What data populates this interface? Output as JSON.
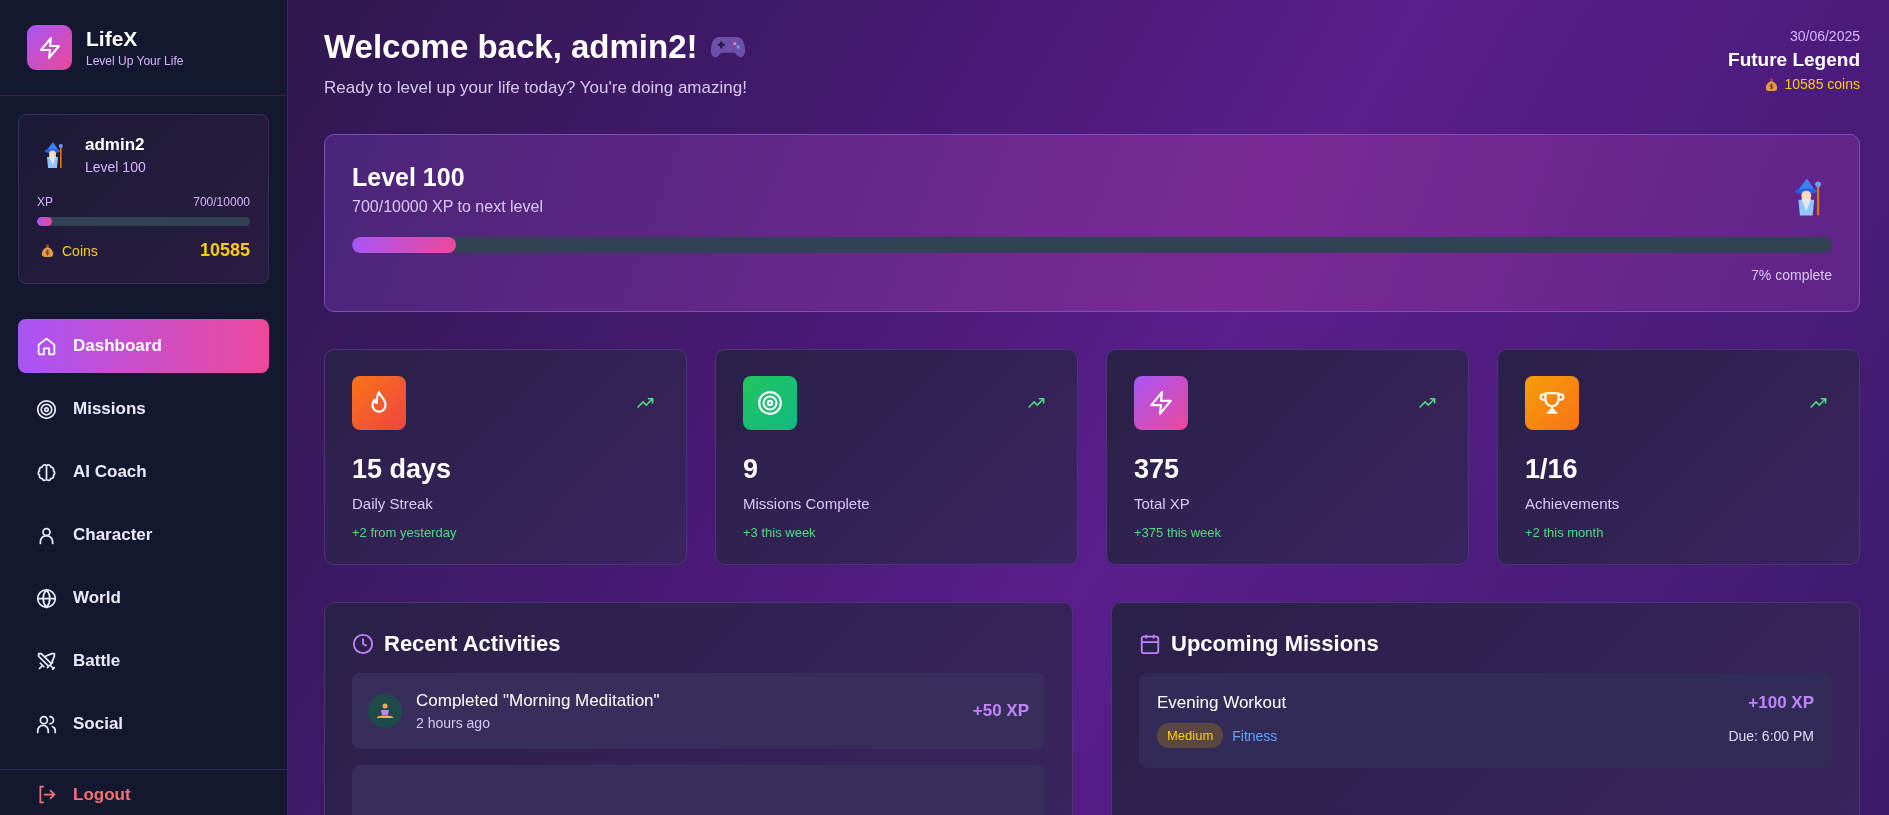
{
  "brand": {
    "name": "LifeX",
    "tagline": "Level Up Your Life"
  },
  "profile": {
    "username": "admin2",
    "level_label": "Level 100",
    "xp_label": "XP",
    "xp_value": "700/10000",
    "level": 0.07,
    "coins_label": "Coins",
    "coins": "10585"
  },
  "nav": [
    {
      "label": "Dashboard",
      "kind": "home",
      "selected": true
    },
    {
      "label": "Missions",
      "kind": "target",
      "selected": false
    },
    {
      "label": "AI Coach",
      "kind": "brain",
      "selected": false
    },
    {
      "label": "Character",
      "kind": "user",
      "selected": false
    },
    {
      "label": "World",
      "kind": "globe",
      "selected": false
    },
    {
      "label": "Battle",
      "kind": "swords",
      "selected": false
    },
    {
      "label": "Social",
      "kind": "users",
      "selected": false
    }
  ],
  "logout": "Logout",
  "header": {
    "title": "Welcome back, admin2!",
    "subtitle": "Ready to level up your life today? You're doing amazing!",
    "date": "30/06/2025",
    "rank": "Future Legend",
    "coins": "10585 coins"
  },
  "level_card": {
    "title": "Level 100",
    "subtitle": "700/10000 XP to next level",
    "level": 0.07,
    "percent": "7% complete"
  },
  "stats": [
    {
      "kind": "flame",
      "value": "15 days",
      "label": "Daily Streak",
      "change": "+2 from yesterday"
    },
    {
      "kind": "target",
      "value": "9",
      "label": "Missions Complete",
      "change": "+3 this week"
    },
    {
      "kind": "bolt",
      "value": "375",
      "label": "Total XP",
      "change": "+375 this week"
    },
    {
      "kind": "trophy",
      "value": "1/16",
      "label": "Achievements",
      "change": "+2 this month"
    }
  ],
  "recent_activities": {
    "title": "Recent Activities",
    "items": [
      {
        "text": "Completed \"Morning Meditation\"",
        "time": "2 hours ago",
        "xp": "+50 XP"
      }
    ]
  },
  "upcoming_missions": {
    "title": "Upcoming Missions",
    "items": [
      {
        "name": "Evening Workout",
        "difficulty": "Medium",
        "category": "Fitness",
        "xp": "+100 XP",
        "due": "Due: 6:00 PM"
      }
    ]
  }
}
